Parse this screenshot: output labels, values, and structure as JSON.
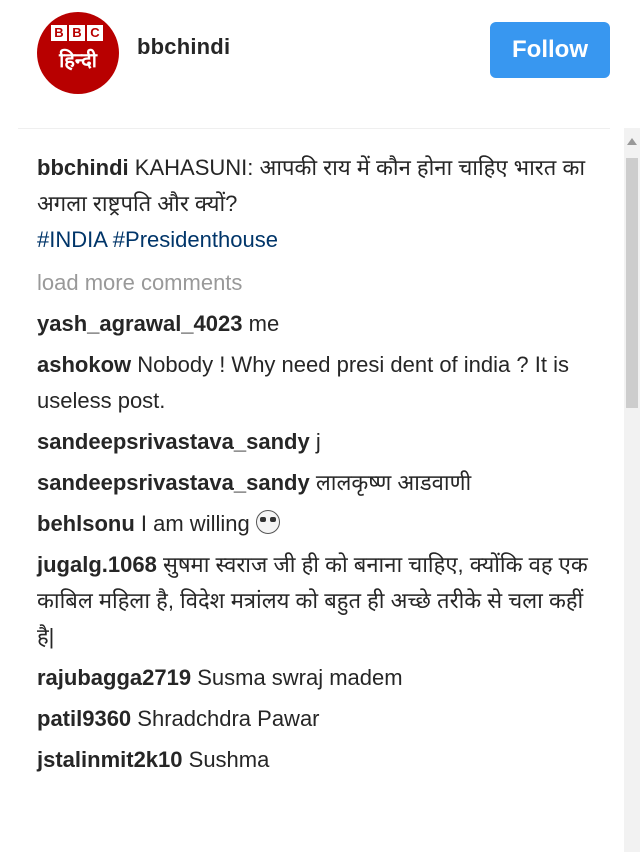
{
  "header": {
    "avatar_logo_letters": [
      "B",
      "B",
      "C"
    ],
    "avatar_logo_script": "हिन्दी",
    "username": "bbchindi",
    "follow_label": "Follow"
  },
  "caption": {
    "user": "bbchindi",
    "text": "KAHASUNI: आपकी राय में कौन होना चाहिए भारत का अगला राष्ट्रपति और क्यों?",
    "hashtags": "#INDIA #Presidenthouse"
  },
  "load_more_label": "load more comments",
  "comments": [
    {
      "user": "yash_agrawal_4023",
      "text": "me"
    },
    {
      "user": "ashokow",
      "text": "Nobody ! Why need presi dent of india ? It is useless post."
    },
    {
      "user": "sandeepsrivastava_sandy",
      "text": "j"
    },
    {
      "user": "sandeepsrivastava_sandy",
      "text": "लालकृष्ण आडवाणी"
    },
    {
      "user": "behlsonu",
      "text": "I am willing",
      "emoji": "sunglasses-emoji"
    },
    {
      "user": "jugalg.1068",
      "text": "सुषमा स्वराज जी ही को बनाना चाहिए, क्योंकि वह एक काबिल महिला है, विदेश मत्रांलय को बहुत ही अच्छे तरीके से चला कहीं है|"
    },
    {
      "user": "rajubagga2719",
      "text": "Susma swraj madem"
    },
    {
      "user": "patil9360",
      "text": "Shradchdra Pawar"
    },
    {
      "user": "jstalinmit2k10",
      "text": "Sushma"
    }
  ],
  "colors": {
    "follow_button": "#3897f0",
    "hashtag": "#003569",
    "bbc_red": "#b80000",
    "muted": "#999999"
  }
}
